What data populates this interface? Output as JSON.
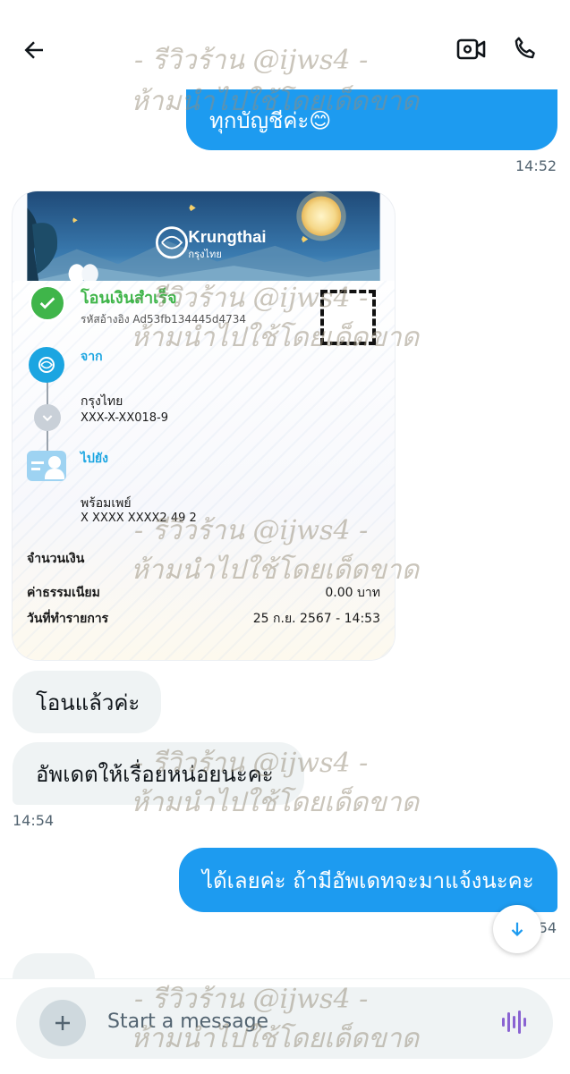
{
  "header": {
    "back_icon": "arrow-left-icon",
    "video_icon": "video-camera-icon",
    "call_icon": "phone-icon"
  },
  "messages": {
    "top_out_text": "ทุกบัญชีค่ะ😊",
    "top_out_time": "14:52",
    "slip": {
      "brand": "Krungthai",
      "brand_thai": "กรุงไทย",
      "status": "โอนเงินสำเร็จ",
      "ref": "รหัสอ้างอิง Ad53fb134445d4734",
      "from_label": "จาก",
      "from_bank": "กรุงไทย",
      "from_account": "XXX-X-XX018-9",
      "to_label": "ไปยัง",
      "to_bank": "พร้อมเพย์",
      "to_account": "X XXXX XXXX2 49 2",
      "amount_label": "จำนวนเงิน",
      "fee_label": "ค่าธรรมเนียม",
      "fee_value": "0.00 บาท",
      "date_label": "วันที่ทำรายการ",
      "date_value": "25 ก.ย. 2567 - 14:53"
    },
    "in_1": "โอนแล้วค่ะ",
    "in_2": "อัพเดตให้เรื่อยหน่อยนะคะ",
    "in_time": "14:54",
    "out_2": "ได้เลยค่ะ ถ้ามีอัพเดทจะมาแจ้งนะคะ",
    "out_2_time": "14:54"
  },
  "watermark": {
    "line1": "-   รีวิวร้าน @ijws4   -",
    "line2": "ห้ามนำไปใช้โดยเด็ดขาด"
  },
  "composer": {
    "placeholder": "Start a message",
    "add_icon": "plus-icon",
    "voice_icon": "voice-wave-icon"
  },
  "colors": {
    "accent": "#1d9bf0",
    "incoming_bubble": "#eff3f4",
    "slip_green": "#3fb54a",
    "krungthai_blue": "#1ba5e1"
  }
}
